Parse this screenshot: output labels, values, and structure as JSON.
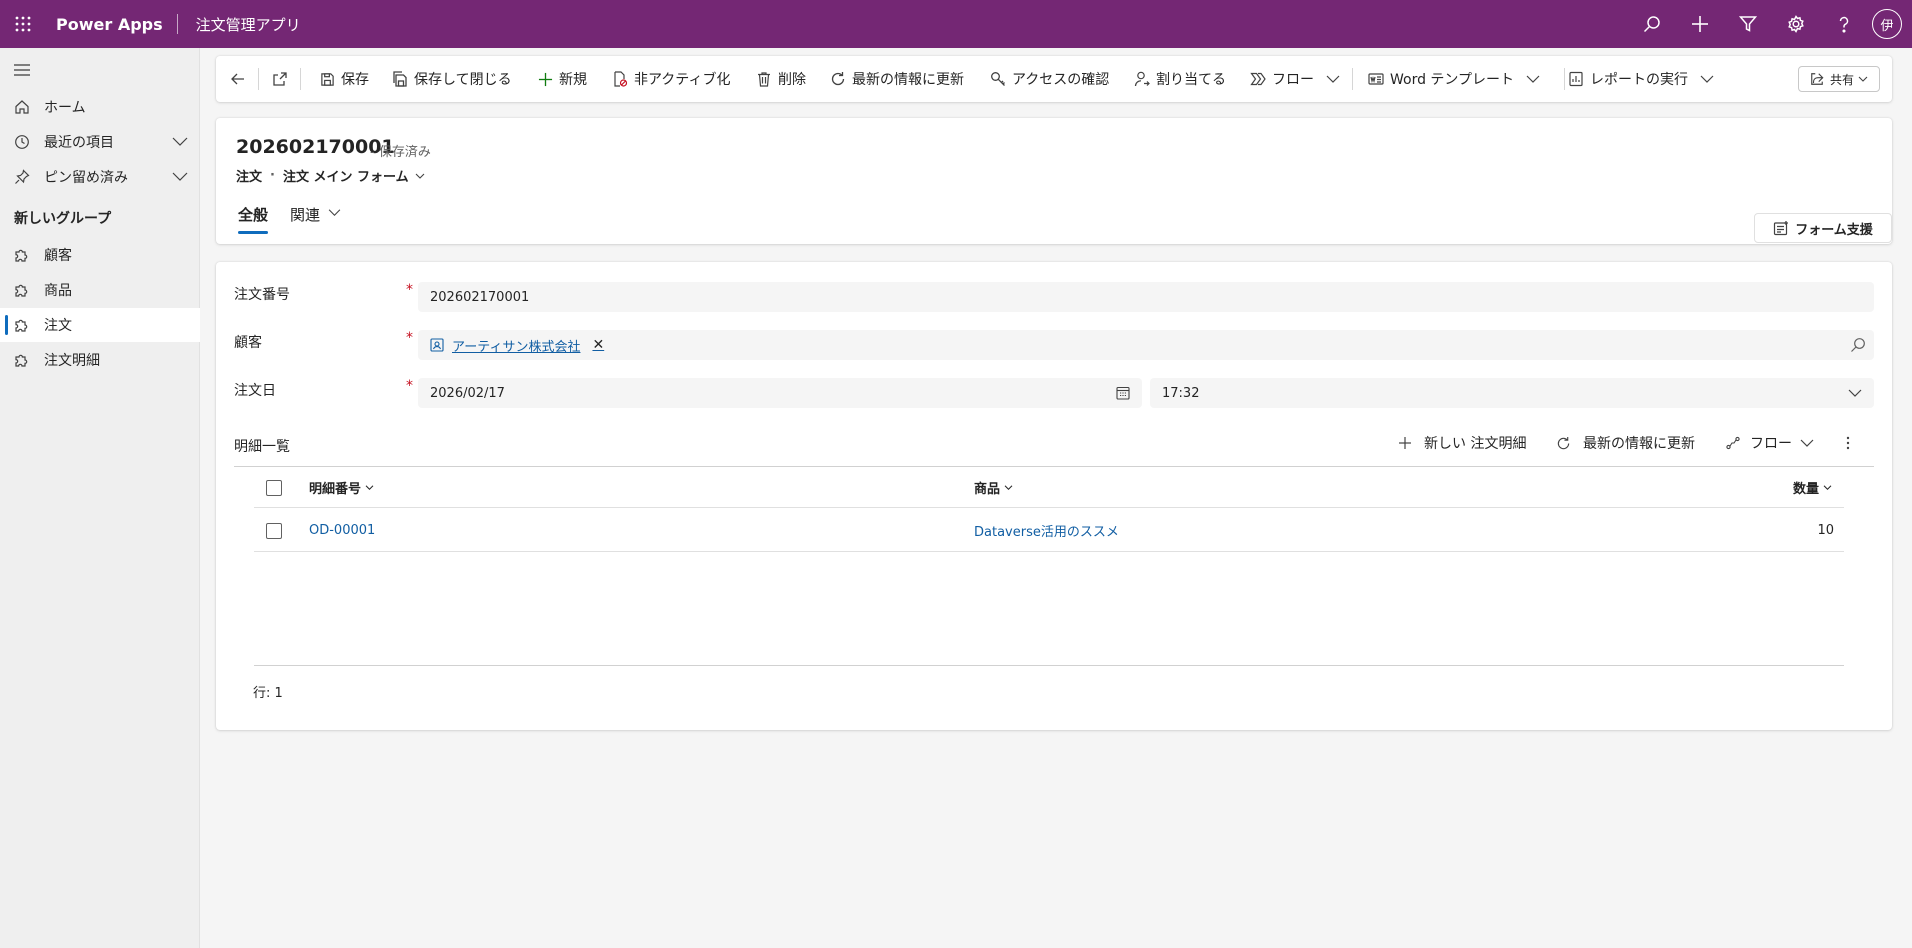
{
  "topbar": {
    "brand": "Power Apps",
    "app_title": "注文管理アプリ",
    "icons": [
      "waffle-icon",
      "search-icon",
      "add-icon",
      "filter-icon",
      "settings-icon",
      "help-icon"
    ],
    "avatar_initial": "伊",
    "color": "#742774"
  },
  "sidebar": {
    "items": [
      {
        "label": "ホーム",
        "icon": "home-icon"
      },
      {
        "label": "最近の項目",
        "icon": "clock-icon"
      },
      {
        "label": "ピン留め済み",
        "icon": "pin-icon"
      }
    ],
    "group_title": "新しいグループ",
    "entities": [
      {
        "label": "顧客",
        "icon": "puzzle-icon"
      },
      {
        "label": "商品",
        "icon": "puzzle-icon"
      },
      {
        "label": "注文",
        "icon": "puzzle-icon",
        "selected": true
      },
      {
        "label": "注文明細",
        "icon": "puzzle-icon"
      }
    ]
  },
  "commandbar": {
    "save": "保存",
    "save_close": "保存して閉じる",
    "new": "新規",
    "deactivate": "非アクティブ化",
    "delete": "削除",
    "refresh": "最新の情報に更新",
    "check_access": "アクセスの確認",
    "assign": "割り当てる",
    "flow": "フロー",
    "word_template": "Word テンプレート",
    "run_report": "レポートの実行",
    "share": "共有"
  },
  "record": {
    "title": "202602170001",
    "status": "- 保存済み",
    "entity": "注文",
    "form_name": "注文 メイン フォーム",
    "tabs": [
      "全般",
      "関連"
    ],
    "form_assist": "フォーム支援"
  },
  "form": {
    "order_number": {
      "label": "注文番号",
      "value": "202602170001"
    },
    "customer": {
      "label": "顧客",
      "value": "アーティサン株式会社"
    },
    "order_date": {
      "label": "注文日",
      "date": "2026/02/17",
      "time": "17:32"
    },
    "required_mark": "*"
  },
  "subgrid": {
    "title": "明細一覧",
    "new_button": "新しい 注文明細",
    "refresh_button": "最新の情報に更新",
    "flow_button": "フロー",
    "columns": [
      "明細番号",
      "商品",
      "数量"
    ],
    "rows": [
      {
        "number": "OD-00001",
        "product": "Dataverse活用のススメ",
        "quantity": "10"
      }
    ],
    "row_count": "行: 1"
  },
  "colors": {
    "accent": "#0f6cbd",
    "link": "#115ea3",
    "required": "#c50f1f"
  }
}
